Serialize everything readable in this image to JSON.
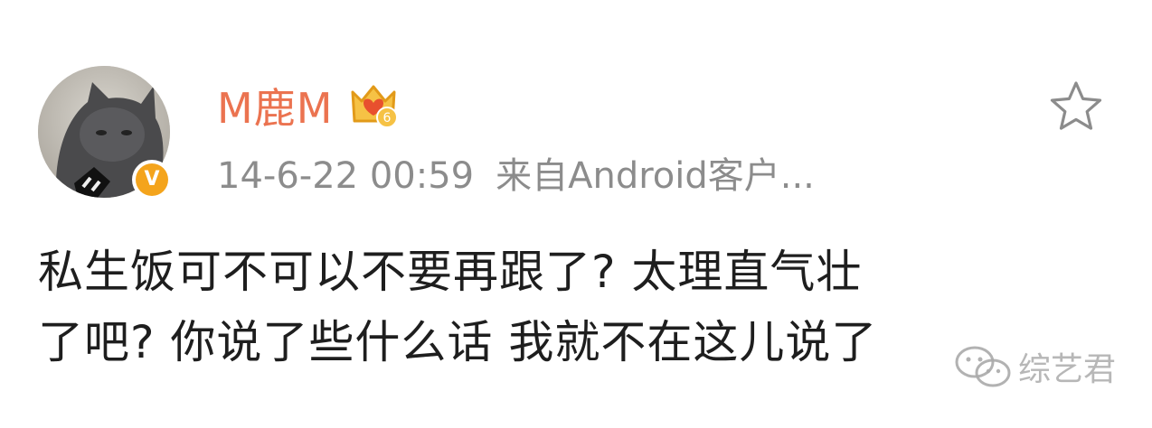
{
  "post": {
    "username": "M鹿M",
    "timestamp": "14-6-22 00:59",
    "source": "来自Android客户...",
    "content_lines": [
      "私生饭可不可以不要再跟了? 太理直气壮",
      "了吧? 你说了些什么话 我就不在这儿说了"
    ],
    "verified_badge": "V",
    "member_badge_level": "6"
  },
  "watermark": {
    "text": "综艺君"
  },
  "icons": {
    "favorite": "star-outline-icon",
    "member": "crown-badge-icon",
    "verified": "verified-v-icon",
    "watermark": "wechat-icon"
  },
  "colors": {
    "username": "#eb7350",
    "meta": "#8c8c8c",
    "verified": "#f4a41c",
    "text": "#1e1e1e"
  }
}
